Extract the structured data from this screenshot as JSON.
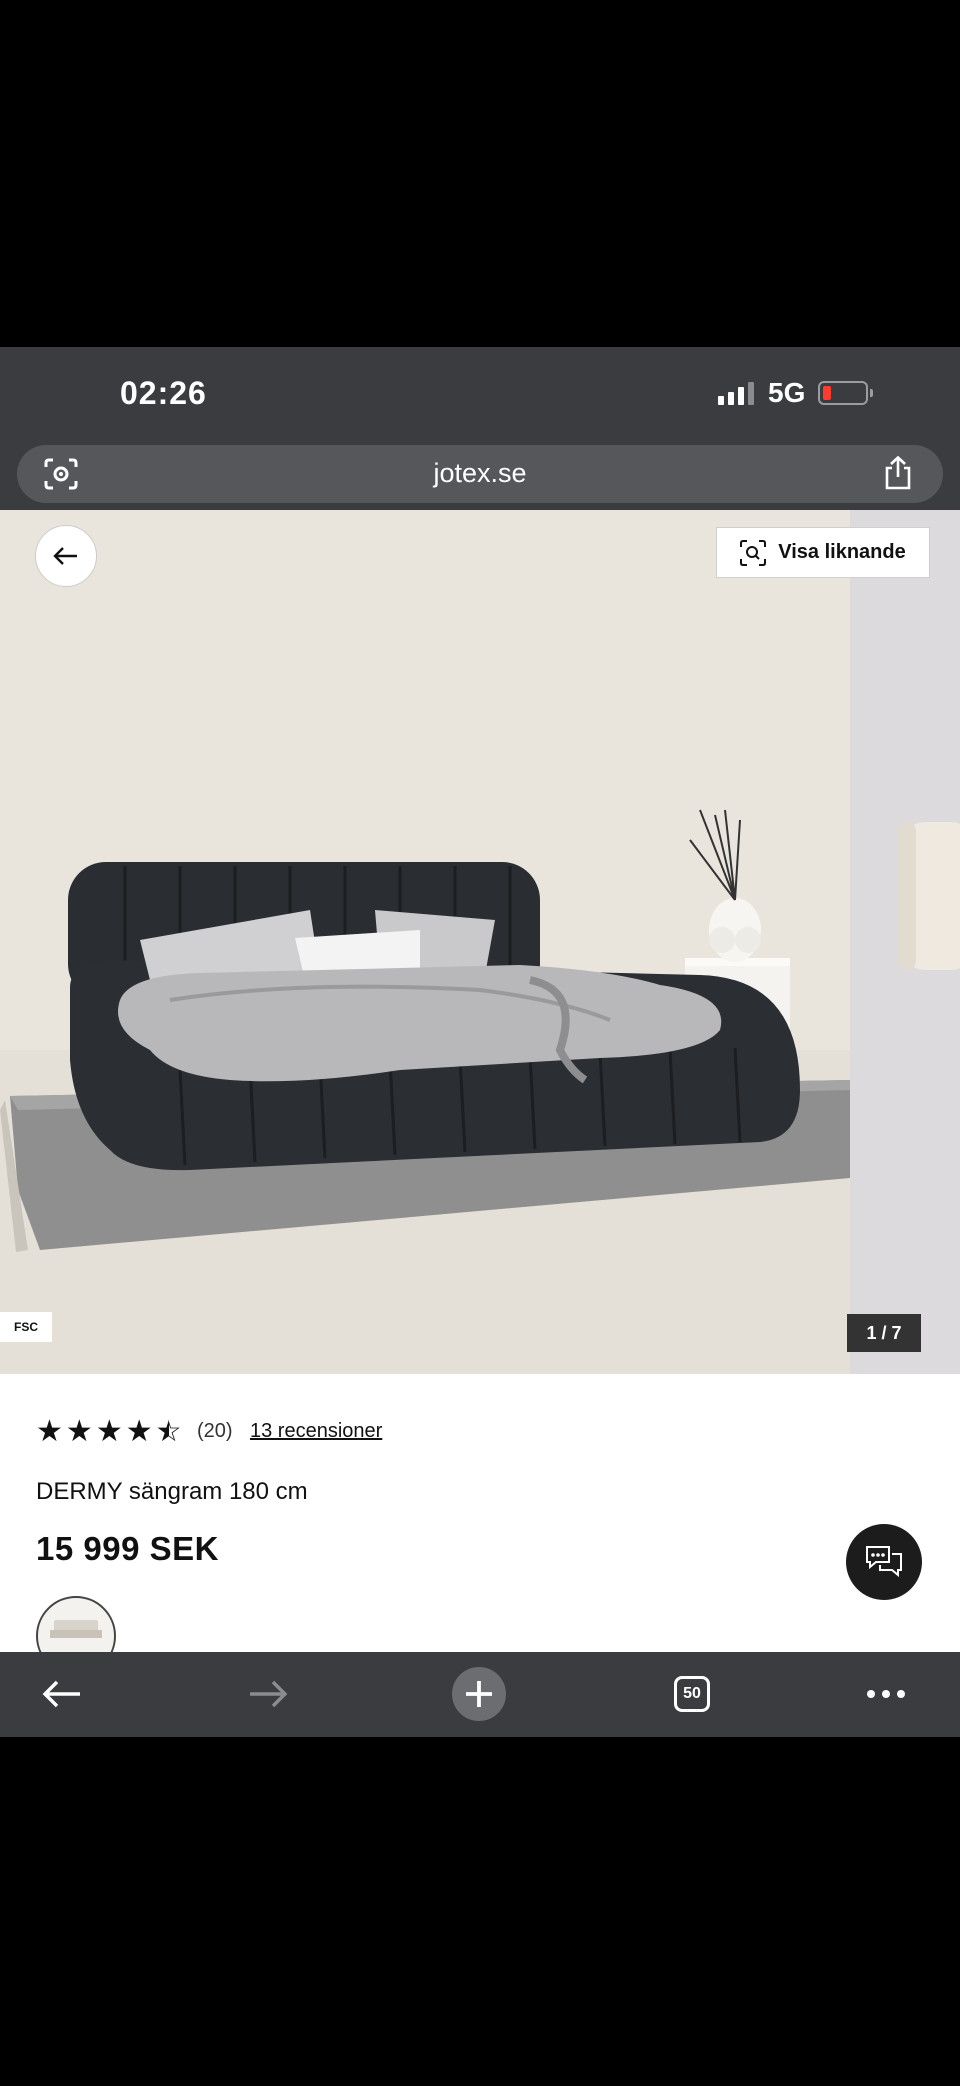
{
  "status_bar": {
    "time": "02:26",
    "network": "5G"
  },
  "browser": {
    "url": "jotex.se"
  },
  "gallery": {
    "similar_label": "Visa liknande",
    "fsc_badge": "FSC",
    "counter": "1 / 7"
  },
  "product": {
    "rating": 4.5,
    "rating_count": "(20)",
    "reviews_link": "13 recensioner",
    "name": "DERMY sängram 180 cm",
    "price": "15 999 SEK"
  },
  "toolbar": {
    "tab_count": "50"
  },
  "colors": {
    "chrome": "#3a3c3f",
    "wall": "#e9e5dd",
    "bed": "#2a2d31",
    "accent_battery": "#ff3b30"
  }
}
